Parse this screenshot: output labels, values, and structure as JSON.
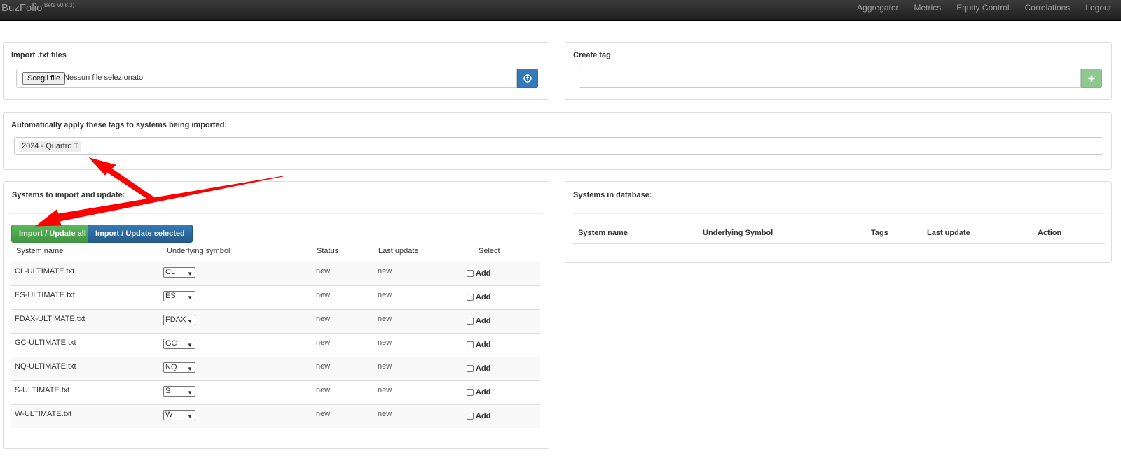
{
  "navbar": {
    "brand": "BuzFolio",
    "version": "(Beta v0.8.3)",
    "links": [
      "Aggregator",
      "Metrics",
      "Equity Control",
      "Correlations",
      "Logout"
    ]
  },
  "import_panel": {
    "title": "Import .txt files",
    "file_button": "Scegli file",
    "file_status": "Nessun file selezionato",
    "upload_icon": "circle-arrow-up-icon"
  },
  "create_tag_panel": {
    "title": "Create tag",
    "input_value": "",
    "add_icon": "plus-icon"
  },
  "auto_tags_panel": {
    "title": "Automatically apply these tags to systems being imported:",
    "tags": [
      "2024 - Quartro T"
    ]
  },
  "systems_import": {
    "title": "Systems to import and update:",
    "import_all_label": "Import / Update all",
    "import_selected_label": "Import / Update selected",
    "columns": [
      "System name",
      "Underlying symbol",
      "Status",
      "Last update",
      "Select"
    ],
    "rows": [
      {
        "name": "CL-ULTIMATE.txt",
        "symbol": "CL",
        "status": "new",
        "last_update": "new",
        "select": "Add"
      },
      {
        "name": "ES-ULTIMATE.txt",
        "symbol": "ES",
        "status": "new",
        "last_update": "new",
        "select": "Add"
      },
      {
        "name": "FDAX-ULTIMATE.txt",
        "symbol": "FDAX",
        "status": "new",
        "last_update": "new",
        "select": "Add"
      },
      {
        "name": "GC-ULTIMATE.txt",
        "symbol": "GC",
        "status": "new",
        "last_update": "new",
        "select": "Add"
      },
      {
        "name": "NQ-ULTIMATE.txt",
        "symbol": "NQ",
        "status": "new",
        "last_update": "new",
        "select": "Add"
      },
      {
        "name": "S-ULTIMATE.txt",
        "symbol": "S",
        "status": "new",
        "last_update": "new",
        "select": "Add"
      },
      {
        "name": "W-ULTIMATE.txt",
        "symbol": "W",
        "status": "new",
        "last_update": "new",
        "select": "Add"
      }
    ]
  },
  "systems_db": {
    "title": "Systems in database:",
    "columns": [
      "System name",
      "Underlying Symbol",
      "Tags",
      "Last update",
      "Action"
    ]
  },
  "annotation": {
    "arrow_color": "#ff0000"
  }
}
